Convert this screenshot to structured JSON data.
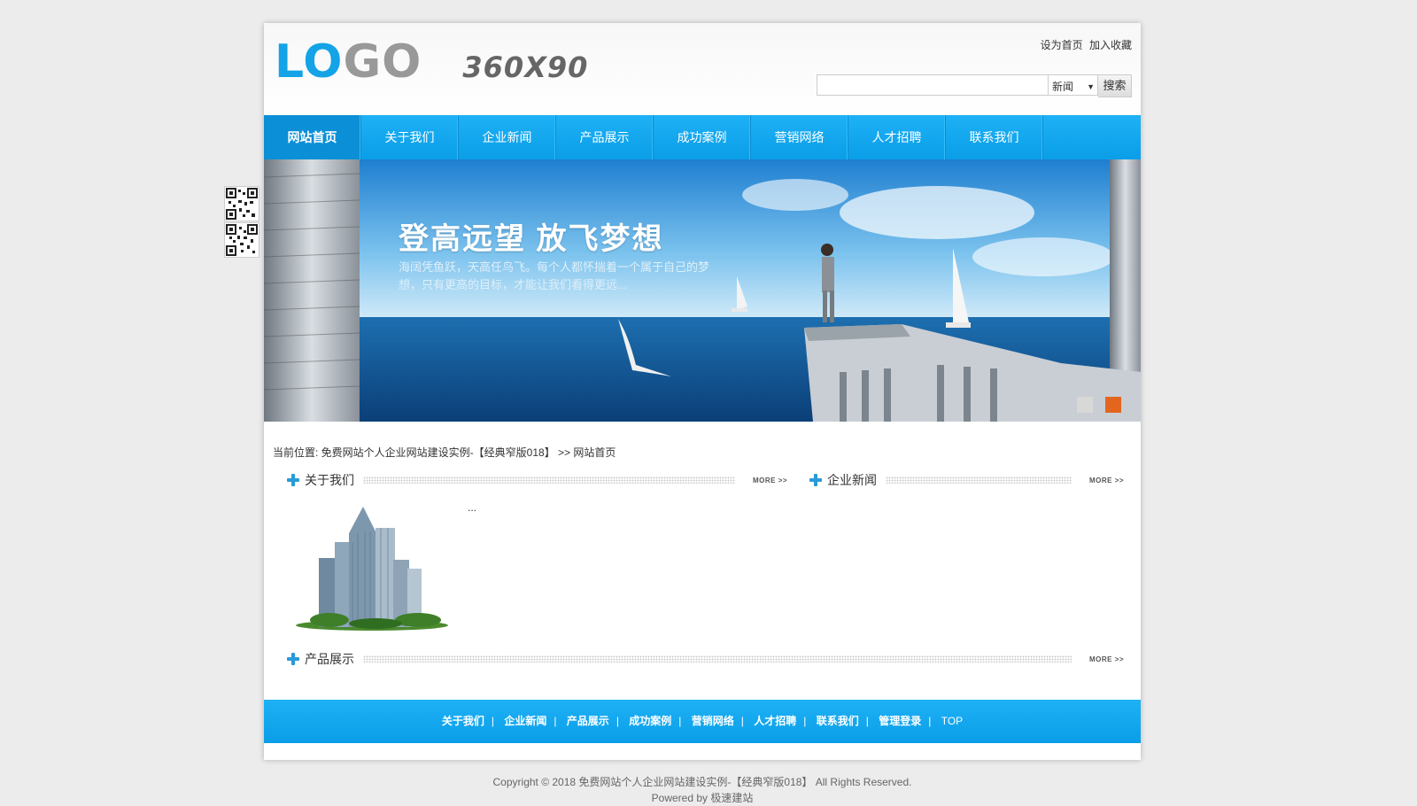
{
  "header": {
    "logo_blue": "LO",
    "logo_grey": "GO",
    "logo_size": "360X90",
    "toplinks": [
      "设为首页",
      "加入收藏"
    ],
    "search": {
      "value": "",
      "placeholder": "",
      "select": "新闻",
      "button": "搜索"
    }
  },
  "nav": {
    "items": [
      "网站首页",
      "关于我们",
      "企业新闻",
      "产品展示",
      "成功案例",
      "营销网络",
      "人才招聘",
      "联系我们"
    ],
    "active_index": 0
  },
  "banner": {
    "title": "登高远望 放飞梦想",
    "subtitle": "海阔凭鱼跃，天高任鸟飞。每个人都怀揣着一个属于自己的梦想，只有更高的目标，才能让我们看得更远..."
  },
  "breadcrumb": {
    "text": "当前位置: 免费网站个人企业网站建设实例-【经典窄版018】 >> 网站首页"
  },
  "sections": {
    "about": {
      "title": "关于我们",
      "more": "MORE >>",
      "excerpt": "..."
    },
    "news": {
      "title": "企业新闻",
      "more": "MORE >>"
    },
    "products": {
      "title": "产品展示",
      "more": "MORE >>"
    }
  },
  "footer": {
    "links": [
      "关于我们",
      "企业新闻",
      "产品展示",
      "成功案例",
      "营销网络",
      "人才招聘",
      "联系我们",
      "管理登录",
      "TOP"
    ],
    "copyright": "Copyright © 2018 免费网站个人企业网站建设实例-【经典窄版018】 All Rights Reserved.",
    "powered": "Powered by 极速建站"
  },
  "colors": {
    "accent": "#14a3e6",
    "nav_active": "#0b8fd6",
    "slide_active": "#e2661e"
  }
}
